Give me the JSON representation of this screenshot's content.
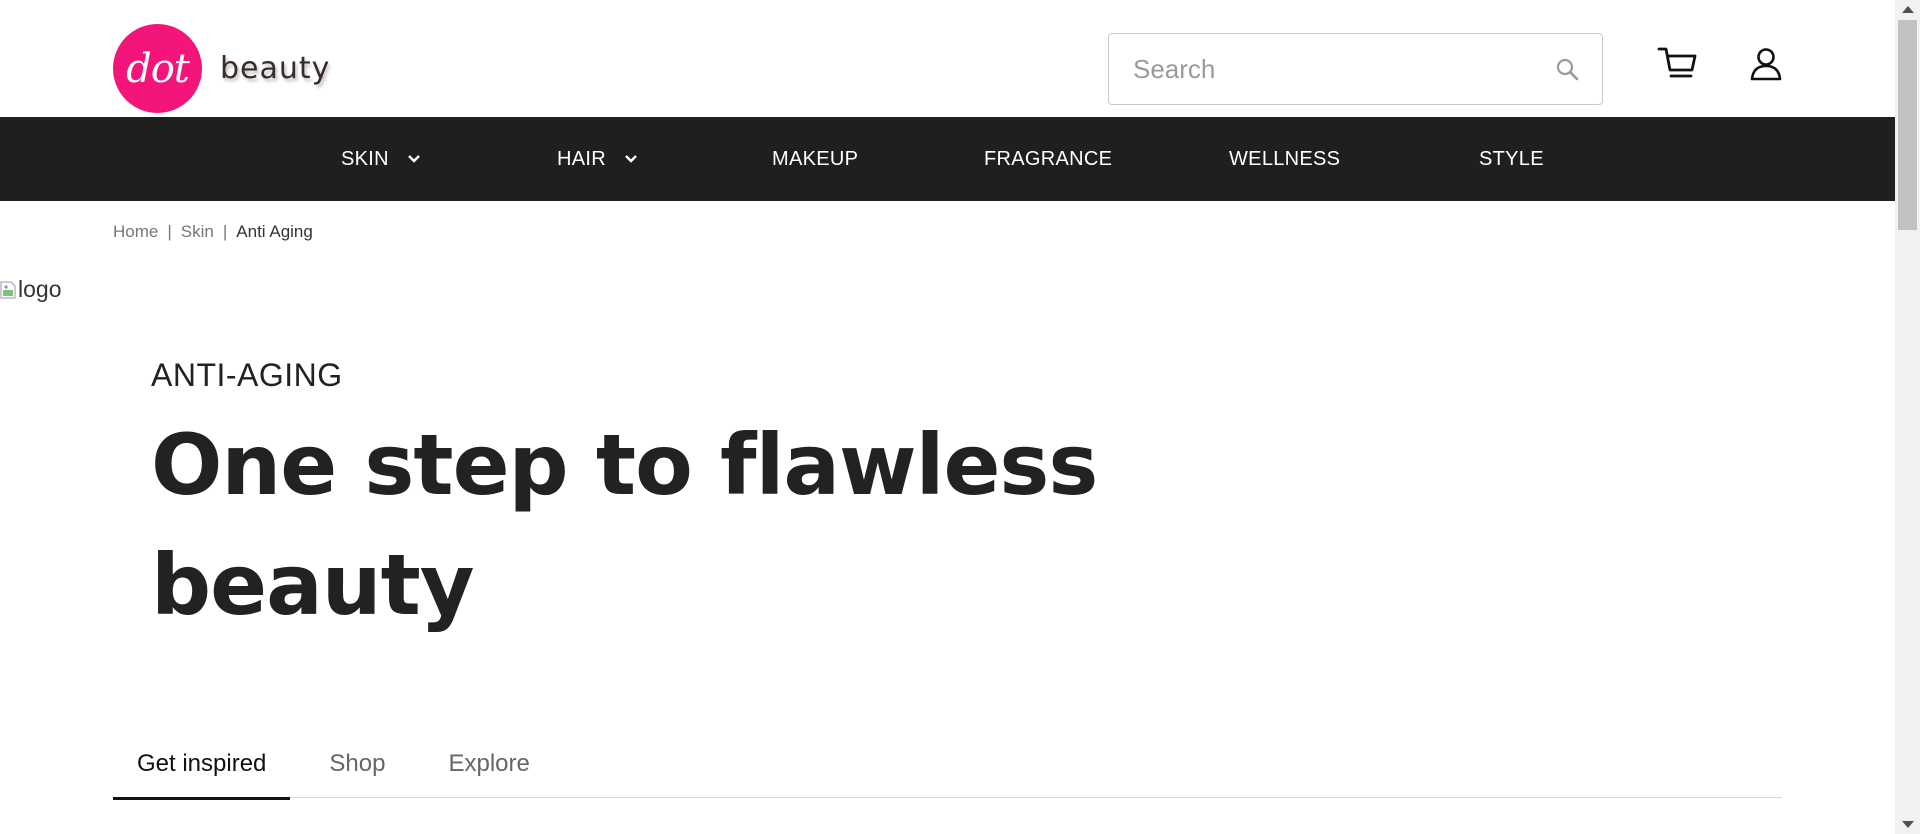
{
  "header": {
    "logo_mark": "dot",
    "logo_word": "beauty",
    "search": {
      "placeholder": "Search",
      "value": ""
    },
    "icons": {
      "search": "search-icon",
      "cart": "cart-icon",
      "account": "user-icon"
    }
  },
  "nav": {
    "items": [
      {
        "label": "SKIN",
        "has_dropdown": true
      },
      {
        "label": "HAIR",
        "has_dropdown": true
      },
      {
        "label": "MAKEUP",
        "has_dropdown": false
      },
      {
        "label": "FRAGRANCE",
        "has_dropdown": false
      },
      {
        "label": "WELLNESS",
        "has_dropdown": false
      },
      {
        "label": "STYLE",
        "has_dropdown": false
      }
    ]
  },
  "breadcrumb": {
    "items": [
      "Home",
      "Skin",
      "Anti Aging"
    ],
    "separator": "|"
  },
  "broken_image": {
    "alt": "logo"
  },
  "hero": {
    "eyebrow": "ANTI-AGING",
    "headline": "One step to flawless beauty"
  },
  "tabs": {
    "items": [
      "Get inspired",
      "Shop",
      "Explore"
    ],
    "active": "Get inspired"
  },
  "colors": {
    "brand_pink": "#f4157b",
    "nav_background": "#1f1f1f",
    "text_dark": "#222222"
  }
}
